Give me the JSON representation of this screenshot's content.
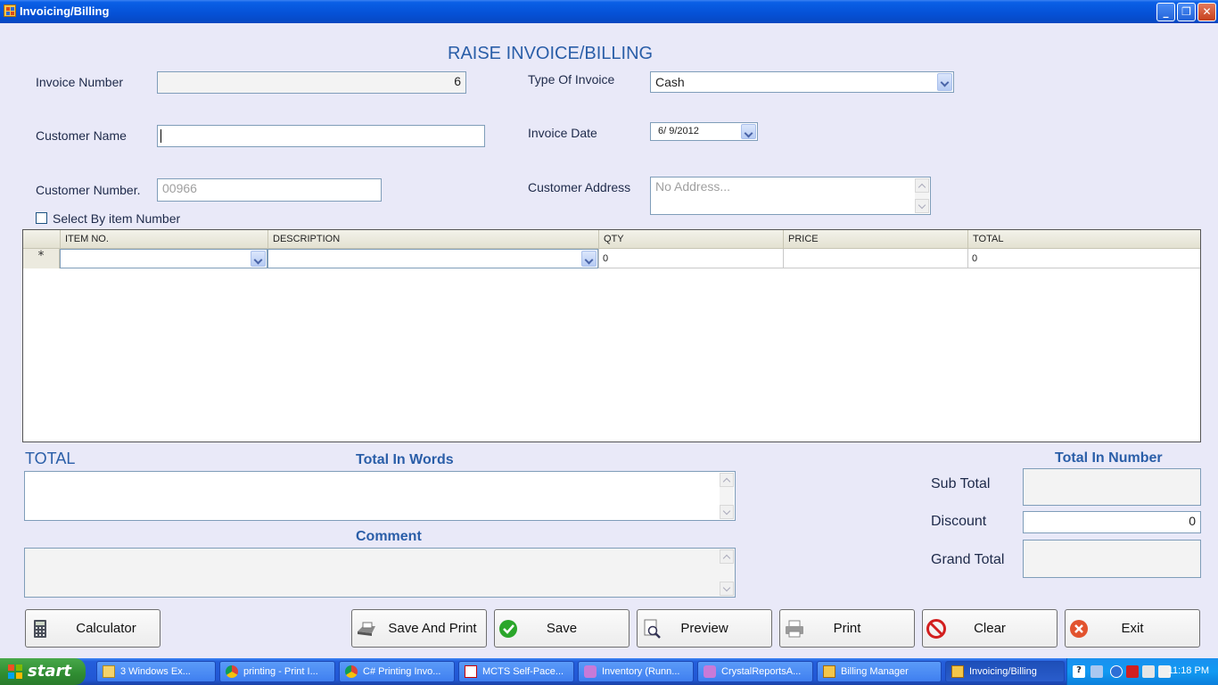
{
  "window": {
    "title": "Invoicing/Billing"
  },
  "header": {
    "heading": "RAISE INVOICE/BILLING"
  },
  "form": {
    "invoice_number_label": "Invoice Number",
    "invoice_number_value": "6",
    "type_of_invoice_label": "Type Of Invoice",
    "type_of_invoice_value": "Cash",
    "customer_name_label": "Customer Name",
    "customer_name_value": "",
    "invoice_date_label": "Invoice Date",
    "invoice_date_value": "6/ 9/2012",
    "customer_number_label": "Customer Number.",
    "customer_number_value": "00966",
    "customer_address_label": "Customer Address",
    "customer_address_placeholder": "No Address...",
    "select_by_item_label": "Select By item Number"
  },
  "grid": {
    "columns": [
      "ITEM NO.",
      "DESCRIPTION",
      "QTY",
      "PRICE",
      "TOTAL"
    ],
    "new_row_marker": "*",
    "new_row": {
      "item_no": "",
      "description": "",
      "qty": "0",
      "price": "",
      "total": "0"
    }
  },
  "totals": {
    "total_heading": "TOTAL",
    "total_in_words_label": "Total In Words",
    "comment_label": "Comment",
    "total_in_number_label": "Total In Number",
    "sub_total_label": "Sub Total",
    "discount_label": "Discount",
    "discount_value": "0",
    "grand_total_label": "Grand Total"
  },
  "buttons": {
    "calculator": "Calculator",
    "save_and_print": "Save And Print",
    "save": "Save",
    "preview": "Preview",
    "print": "Print",
    "clear": "Clear",
    "exit": "Exit"
  },
  "taskbar": {
    "start_label": "start",
    "tasks": [
      "3 Windows Ex...",
      "printing - Print I...",
      "C# Printing Invo...",
      "MCTS Self-Pace...",
      "Inventory (Runn...",
      "CrystalReportsA...",
      "Billing Manager",
      "Invoicing/Billing"
    ],
    "clock": "11:18 PM"
  },
  "colors": {
    "heading": "#2a5ea8",
    "background": "#e9e9f8",
    "titlebar": "#0551d6"
  }
}
